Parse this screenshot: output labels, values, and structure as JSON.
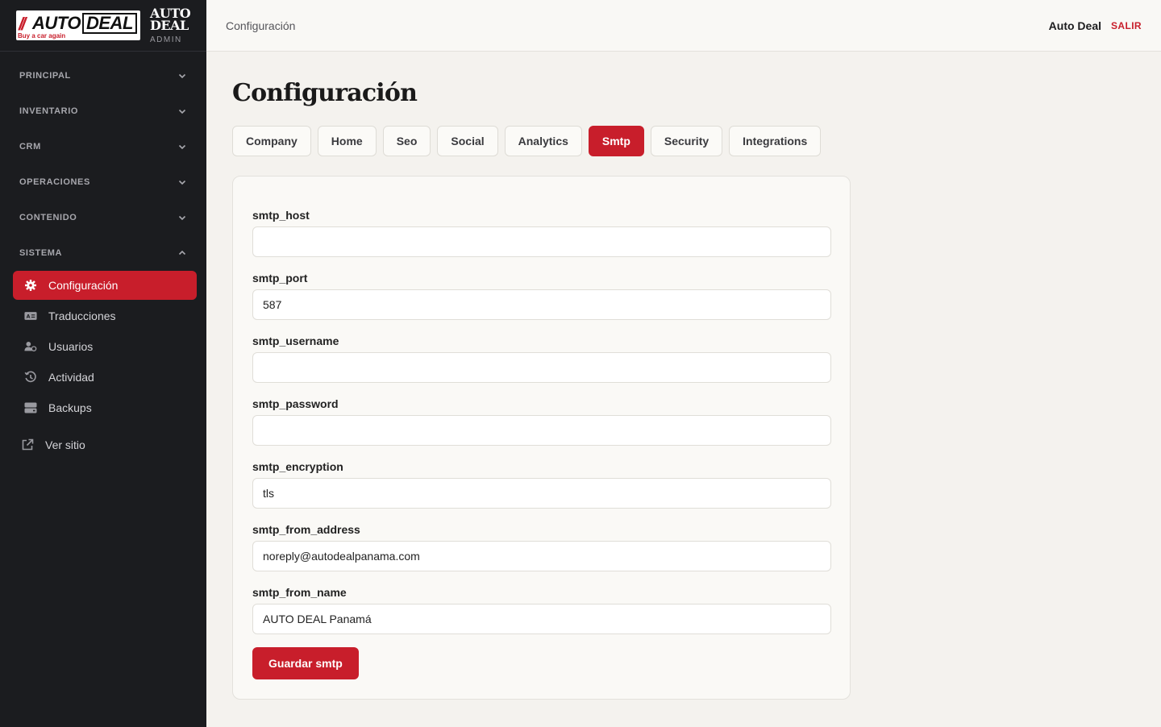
{
  "brand": {
    "logo_text_auto": "AUTO",
    "logo_text_deal": "DEAL",
    "logo_tagline": "Buy a car again",
    "title_line1": "AUTO",
    "title_line2": "DEAL",
    "subtitle": "ADMIN"
  },
  "sidebar": {
    "sections": [
      {
        "label": "PRINCIPAL",
        "icon": "chevron-down-icon"
      },
      {
        "label": "INVENTARIO",
        "icon": "chevron-down-icon"
      },
      {
        "label": "CRM",
        "icon": "chevron-down-icon"
      },
      {
        "label": "OPERACIONES",
        "icon": "chevron-down-icon"
      },
      {
        "label": "CONTENIDO",
        "icon": "chevron-down-icon"
      },
      {
        "label": "SISTEMA",
        "icon": "chevron-up-icon"
      }
    ],
    "items": [
      {
        "label": "Configuración",
        "icon": "gear-icon",
        "active": true
      },
      {
        "label": "Traducciones",
        "icon": "language-icon"
      },
      {
        "label": "Usuarios",
        "icon": "users-icon"
      },
      {
        "label": "Actividad",
        "icon": "history-icon"
      },
      {
        "label": "Backups",
        "icon": "database-icon"
      }
    ],
    "external": {
      "label": "Ver sitio",
      "icon": "external-link-icon"
    }
  },
  "topbar": {
    "breadcrumb": "Configuración",
    "user": "Auto Deal",
    "logout": "SALIR"
  },
  "page": {
    "title": "Configuración"
  },
  "tabs": [
    {
      "label": "Company"
    },
    {
      "label": "Home"
    },
    {
      "label": "Seo"
    },
    {
      "label": "Social"
    },
    {
      "label": "Analytics"
    },
    {
      "label": "Smtp",
      "active": true
    },
    {
      "label": "Security"
    },
    {
      "label": "Integrations"
    }
  ],
  "form": {
    "fields": [
      {
        "label": "smtp_host",
        "value": ""
      },
      {
        "label": "smtp_port",
        "value": "587"
      },
      {
        "label": "smtp_username",
        "value": ""
      },
      {
        "label": "smtp_password",
        "value": ""
      },
      {
        "label": "smtp_encryption",
        "value": "tls"
      },
      {
        "label": "smtp_from_address",
        "value": "noreply@autodealpanama.com"
      },
      {
        "label": "smtp_from_name",
        "value": "AUTO DEAL Panamá"
      }
    ],
    "submit_label": "Guardar smtp"
  },
  "colors": {
    "accent": "#c81e2b",
    "sidebar_bg": "#1b1c1f",
    "page_bg": "#f4f2ee"
  }
}
